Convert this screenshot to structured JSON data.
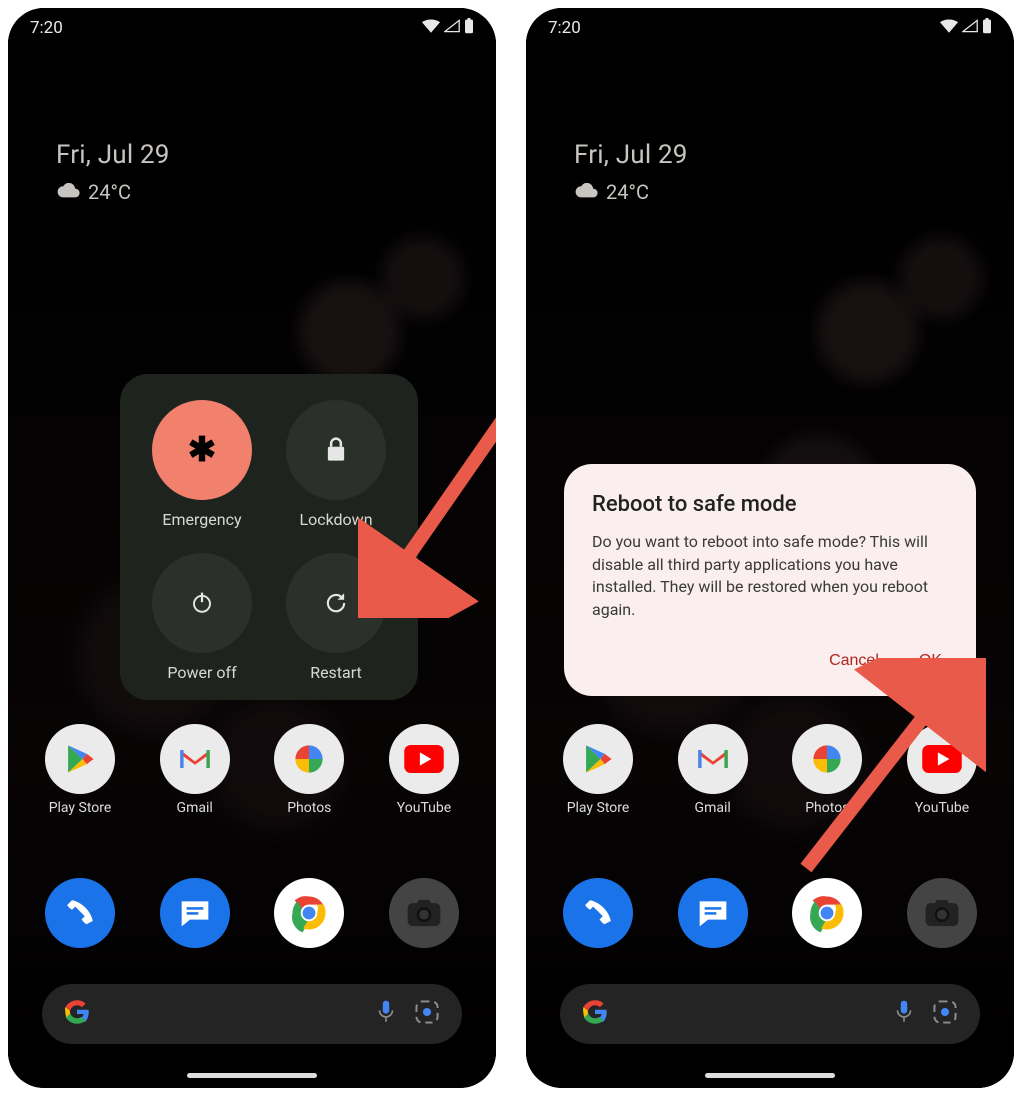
{
  "status": {
    "time": "7:20"
  },
  "widget": {
    "date": "Fri, Jul 29",
    "temp": "24°C"
  },
  "apps": {
    "row1": [
      {
        "label": "Play Store"
      },
      {
        "label": "Gmail"
      },
      {
        "label": "Photos"
      },
      {
        "label": "YouTube"
      }
    ]
  },
  "dock": [
    {
      "label": ""
    },
    {
      "label": ""
    },
    {
      "label": ""
    },
    {
      "label": ""
    }
  ],
  "power_menu": {
    "emergency": "Emergency",
    "lockdown": "Lockdown",
    "poweroff": "Power off",
    "restart": "Restart"
  },
  "dialog": {
    "title": "Reboot to safe mode",
    "body": "Do you want to reboot into safe mode? This will disable all third party applications you have installed. They will be restored when you reboot again.",
    "cancel": "Cancel",
    "ok": "OK"
  }
}
